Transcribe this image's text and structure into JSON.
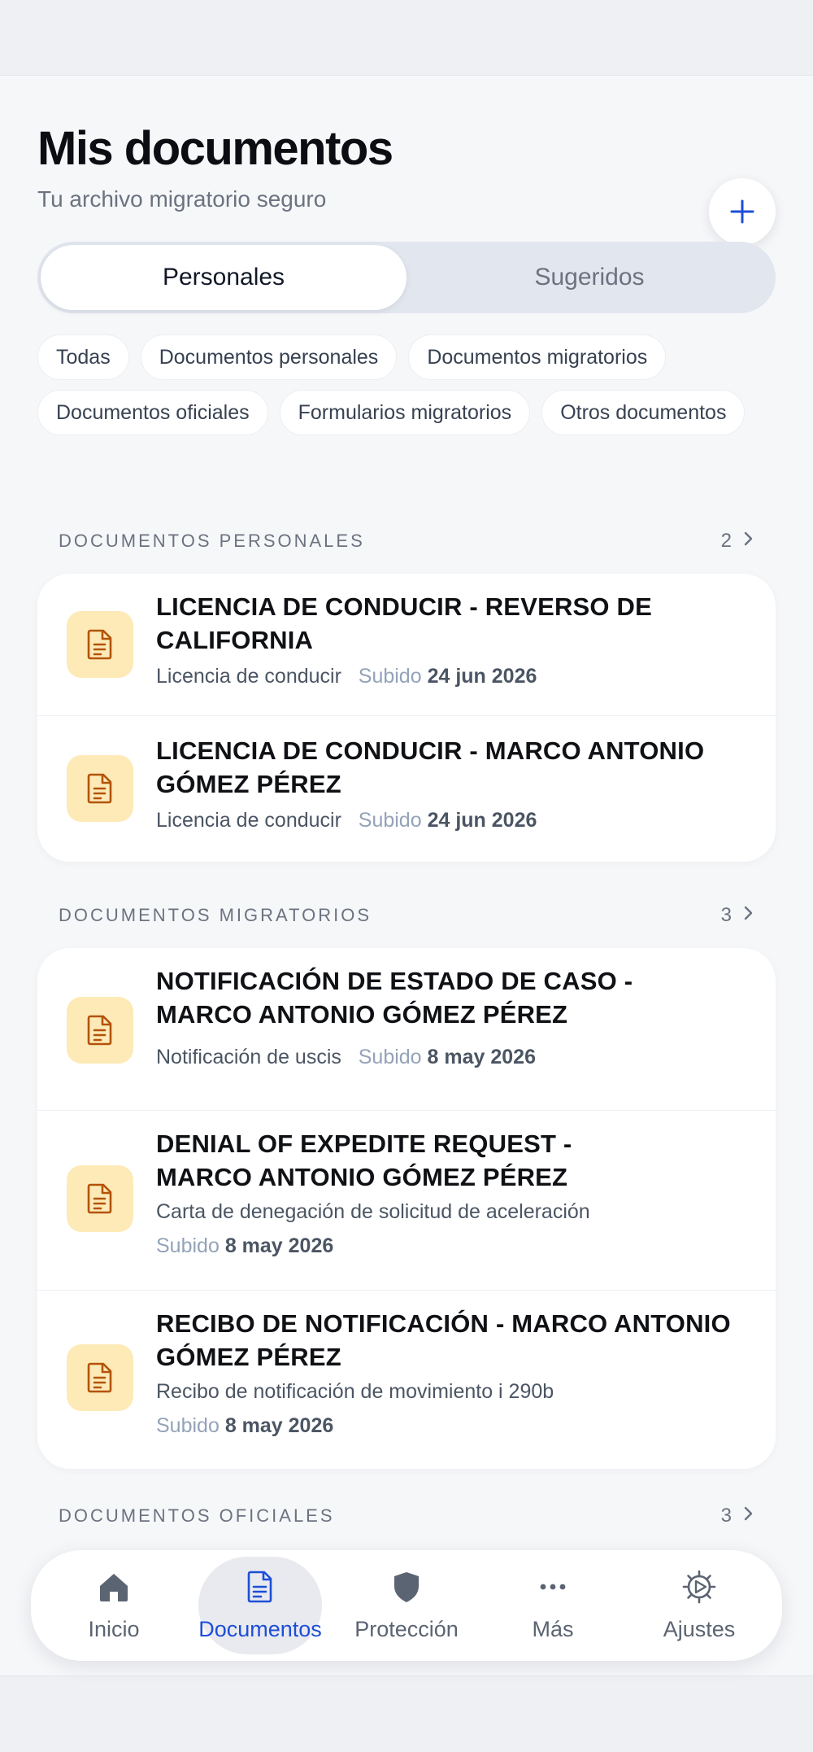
{
  "header": {
    "title": "Mis documentos",
    "subtitle": "Tu archivo migratorio seguro",
    "add_icon": "plus-icon"
  },
  "segments": [
    {
      "label": "Personales",
      "active": true
    },
    {
      "label": "Sugeridos",
      "active": false
    }
  ],
  "filters": [
    "Todas",
    "Documentos personales",
    "Documentos migratorios",
    "Documentos oficiales",
    "Formularios migratorios",
    "Otros documentos"
  ],
  "sections": [
    {
      "title": "DOCUMENTOS PERSONALES",
      "count": "2",
      "items": [
        {
          "title_lines": [
            "LICENCIA DE CONDUCIR - REVERSO DE",
            "CALIFORNIA"
          ],
          "type": "Licencia de conducir",
          "uploaded_label": "Subido",
          "date": "24 jun 2026"
        },
        {
          "title_lines": [
            "LICENCIA DE CONDUCIR - MARCO ANTONIO",
            "GÓMEZ PÉREZ"
          ],
          "type": "Licencia de conducir",
          "uploaded_label": "Subido",
          "date": "24 jun 2026"
        }
      ]
    },
    {
      "title": "DOCUMENTOS MIGRATORIOS",
      "count": "3",
      "items": [
        {
          "title_lines": [
            "NOTIFICACIÓN DE ESTADO DE CASO -",
            "MARCO ANTONIO GÓMEZ PÉREZ"
          ],
          "type": "Notificación de uscis",
          "uploaded_label": "Subido",
          "date": "8 may 2026"
        },
        {
          "title_lines": [
            "DENIAL OF EXPEDITE REQUEST -",
            "MARCO ANTONIO GÓMEZ PÉREZ"
          ],
          "type": "Carta de denegación de solicitud de aceleración",
          "uploaded_label": "Subido",
          "date": "8 may 2026"
        },
        {
          "title_lines": [
            "RECIBO DE NOTIFICACIÓN - MARCO ANTONIO",
            "GÓMEZ PÉREZ"
          ],
          "type": "Recibo de notificación de movimiento i 290b",
          "uploaded_label": "Subido",
          "date": "8 may 2026"
        }
      ]
    },
    {
      "title": "DOCUMENTOS OFICIALES",
      "count": "3",
      "items": []
    }
  ],
  "tabbar": [
    {
      "label": "Inicio",
      "icon": "home-icon",
      "active": false
    },
    {
      "label": "Documentos",
      "icon": "document-icon",
      "active": true
    },
    {
      "label": "Protección",
      "icon": "shield-icon",
      "active": false
    },
    {
      "label": "Más",
      "icon": "more-icon",
      "active": false
    },
    {
      "label": "Ajustes",
      "icon": "settings-icon",
      "active": false
    }
  ],
  "colors": {
    "accent": "#1d4ed8",
    "doc_icon_bg": "#fdeab7",
    "doc_icon": "#b45309"
  }
}
